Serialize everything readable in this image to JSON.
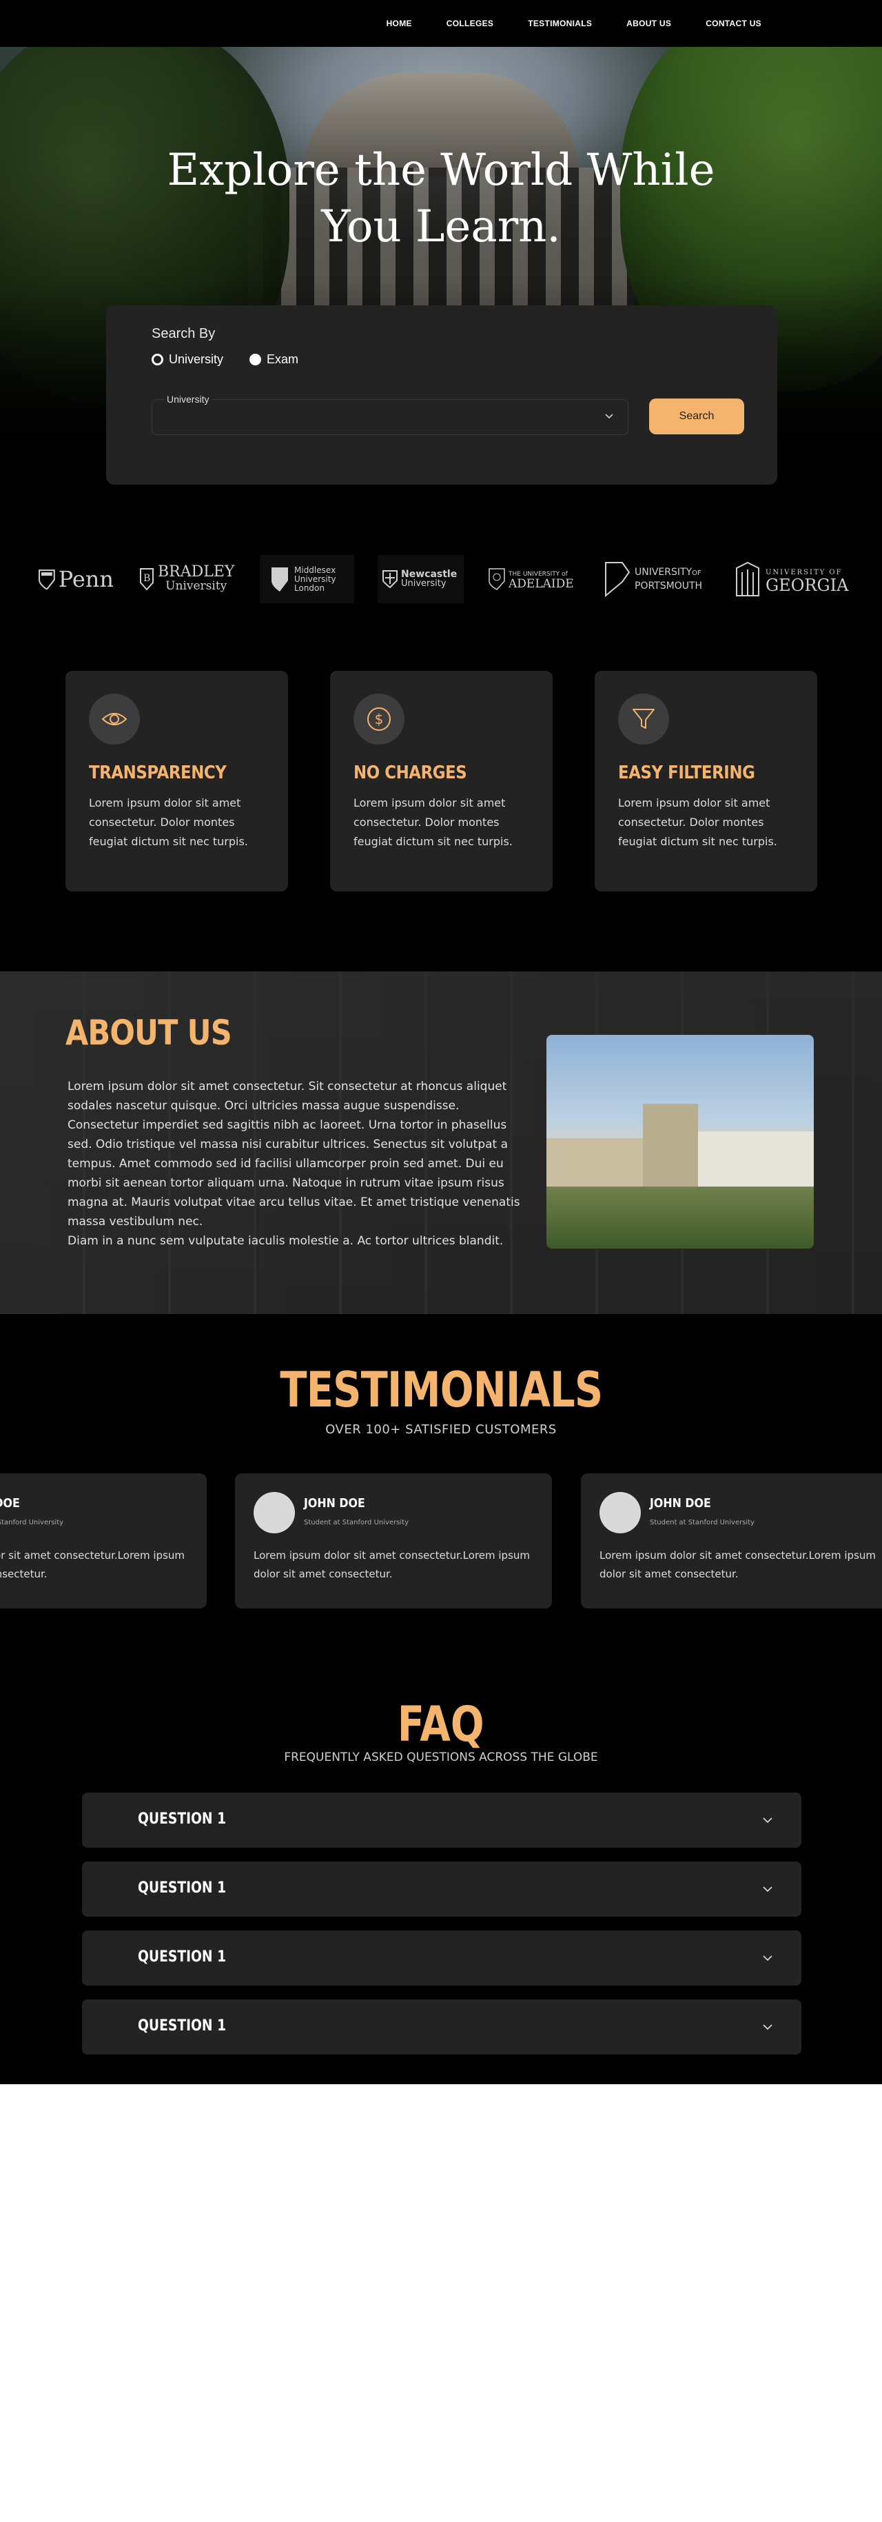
{
  "nav": {
    "items": [
      {
        "label": "HOME"
      },
      {
        "label": "COLLEGES"
      },
      {
        "label": "TESTIMONIALS"
      },
      {
        "label": "ABOUT US"
      },
      {
        "label": "CONTACT US"
      }
    ]
  },
  "hero": {
    "title_line1": "Explore the World While",
    "title_line2": "You Learn."
  },
  "search": {
    "heading": "Search By",
    "options": [
      {
        "label": "University",
        "selected": false
      },
      {
        "label": "Exam",
        "selected": true
      }
    ],
    "select_label": "University",
    "select_value": "",
    "button_label": "Search"
  },
  "logos": [
    {
      "name": "Penn"
    },
    {
      "name": "BRADLEY",
      "sub": "University"
    },
    {
      "name": "Middlesex",
      "sub": "University",
      "sub2": "London"
    },
    {
      "name": "Newcastle",
      "sub": "University"
    },
    {
      "name": "ADELAIDE",
      "pre": "THE UNIVERSITY of"
    },
    {
      "name": "UNIVERSITY",
      "sub": "PORTSMOUTH",
      "of": "OF"
    },
    {
      "name": "GEORGIA",
      "pre": "UNIVERSITY OF"
    }
  ],
  "features": [
    {
      "icon": "eye-icon",
      "title": "TRANSPARENCY",
      "text": "Lorem ipsum dolor sit amet consectetur. Dolor montes feugiat dictum sit nec turpis."
    },
    {
      "icon": "dollar-icon",
      "title": "NO CHARGES",
      "text": "Lorem ipsum dolor sit amet consectetur. Dolor montes feugiat dictum sit nec turpis."
    },
    {
      "icon": "filter-icon",
      "title": "EASY FILTERING",
      "text": "Lorem ipsum dolor sit amet consectetur. Dolor montes feugiat dictum sit nec turpis."
    }
  ],
  "about": {
    "title": "ABOUT US",
    "paragraph": "Lorem ipsum dolor sit amet consectetur. Sit consectetur at rhoncus aliquet sodales nascetur quisque. Orci ultricies massa augue suspendisse. Consectetur imperdiet sed sagittis nibh ac laoreet. Urna tortor in phasellus sed. Odio tristique vel massa nisi curabitur ultrices. Senectus sit volutpat a tempus. Amet commodo sed id facilisi ullamcorper proin sed amet. Dui eu morbi sit aenean tortor aliquam urna. Natoque in rutrum vitae ipsum risus magna at. Mauris volutpat vitae arcu tellus vitae. Et amet tristique venenatis massa vestibulum nec.",
    "paragraph2": "Diam in a nunc sem vulputate iaculis molestie a. Ac tortor ultrices blandit."
  },
  "testimonials": {
    "title": "TESTIMONIALS",
    "subtitle": "OVER 100+ SATISFIED  CUSTOMERS",
    "cards": [
      {
        "name": "JOHN DOE",
        "role": "Student at Stanford University",
        "quote": "Lorem ipsum dolor sit amet consectetur.Lorem ipsum dolor sit amet consectetur."
      },
      {
        "name": "JOHN DOE",
        "role": "Student at Stanford University",
        "quote": "Lorem ipsum dolor sit amet consectetur.Lorem ipsum dolor sit amet consectetur."
      },
      {
        "name": "JOHN DOE",
        "role": "Student at Stanford University",
        "quote": "Lorem ipsum dolor sit amet consectetur.Lorem ipsum dolor sit amet consectetur."
      }
    ]
  },
  "faq": {
    "title": "FAQ",
    "subtitle": "FREQUENTLY ASKED QUESTIONS ACROSS THE GLOBE",
    "items": [
      {
        "question": "QUESTION 1"
      },
      {
        "question": "QUESTION 1"
      },
      {
        "question": "QUESTION 1"
      },
      {
        "question": "QUESTION 1"
      }
    ]
  },
  "colors": {
    "accent": "#f4b46e",
    "card": "#232323",
    "background": "#000000"
  }
}
